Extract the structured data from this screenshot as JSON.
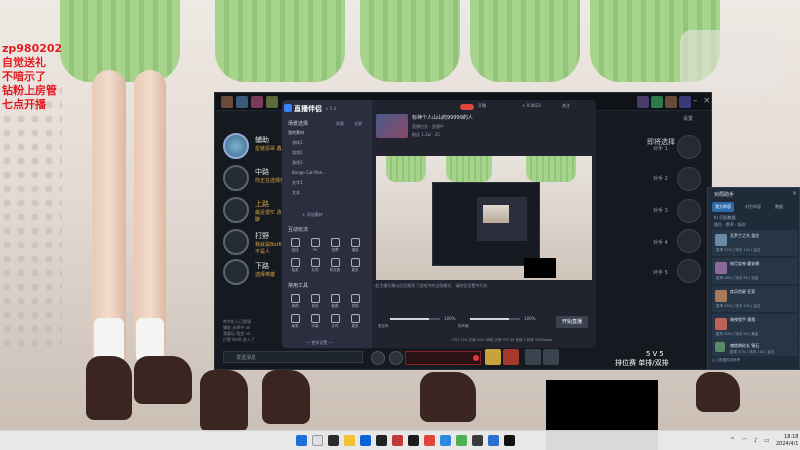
{
  "overlay": {
    "lines": [
      "zp980202",
      "自觉送礼",
      "不喑示了",
      "钻粉上房管",
      "七点开播"
    ]
  },
  "client": {
    "players": [
      {
        "role": "辅助",
        "sub": "星链恩哥 鑫小诗"
      },
      {
        "role": "中路",
        "sub": "你正在选择英雄"
      },
      {
        "role": "上路",
        "sub": "最近很忙 改天再聊"
      },
      {
        "role": "打野",
        "sub": "我就是Bot6 我不是人"
      },
      {
        "role": "下路",
        "sub": "选择英雄"
      }
    ],
    "right_header": "即将选择",
    "opponents": [
      "对手 1",
      "对手 2",
      "对手 3",
      "对手 4",
      "对手 5"
    ],
    "corner_label": "设置",
    "chat_lines": [
      "帝字拒入已是服",
      "辅助 选择中 ok",
      "我要玩 我是 ok",
      "打野 Bot6 进入了"
    ],
    "chat_placeholder": "发送消息",
    "svs": "5V5",
    "mode": "排位赛 单排/双排"
  },
  "stream": {
    "brand": "直播伴侣",
    "version": "v 5.4",
    "scene_label": "场景选择",
    "tags": [
      "场景",
      "全屏"
    ],
    "source_header": "我的素材",
    "sources": [
      "游戏1",
      "游戏2",
      "游戏3",
      "Bongo Cat Mve...",
      "文字1",
      "文本"
    ],
    "add_source": "+ 添加素材",
    "interaction_header": "互动玩法",
    "interaction_tools": [
      "连线",
      "PK",
      "投票",
      "福袋",
      "抽奖",
      "礼物",
      "粉丝团",
      "更多"
    ],
    "tools_header": "常用工具",
    "common_tools": [
      "美颜",
      "音效",
      "截图",
      "录制",
      "画笔",
      "字幕",
      "计时",
      "更多"
    ],
    "side_footer": "— 更多设置 —",
    "room_title": "标神个人山山的99999的人",
    "room_meta": "直播信息 · 直播中",
    "room_meta2": "粉丝 1.2w · 25",
    "top_tags": [
      "开播",
      "+ 0.0023",
      "关注"
    ],
    "preview_tip": "·若主播开播以后切换到了游戏中的全屏模式、请前往设置中开启",
    "sliders": [
      {
        "label": "麦克风",
        "value": "100%",
        "level": 0.78
      },
      {
        "label": "扬声器",
        "value": "100%",
        "level": 0.78
      }
    ],
    "start_button": "开始直播",
    "status_line": "CPU 12%  内存 40%  网络 正常  FPS 30  丢帧 0  码率 2500kbps"
  },
  "helper": {
    "title": "对局助手",
    "tabs": [
      "我方阵容",
      "对方阵容",
      "数据"
    ],
    "subtitle": "Kr 匹配数据",
    "subtitle2": "段位 · 胜率 · 场次",
    "cards": [
      {
        "name": "瓦罗兰之光 盖伦",
        "stats": "胜率 52% | 场次 120 | 钻石"
      },
      {
        "name": "皎月女神 戴安娜",
        "stats": "胜率 48% | 场次 88 | 铂金"
      },
      {
        "name": "疾风剑豪 亚索",
        "stats": "胜率 55% | 场次 200 | 钻石"
      },
      {
        "name": "暗夜猎手 薇恩",
        "stats": "胜率 50% | 场次 64 | 黄金"
      },
      {
        "name": "魂锁典狱长 锤石",
        "stats": "胜率 57% | 场次 150 | 钻石"
      }
    ],
    "footer": "以上数据仅供参考"
  },
  "taskbar": {
    "time": "18:18",
    "date": "2024/4/1"
  }
}
